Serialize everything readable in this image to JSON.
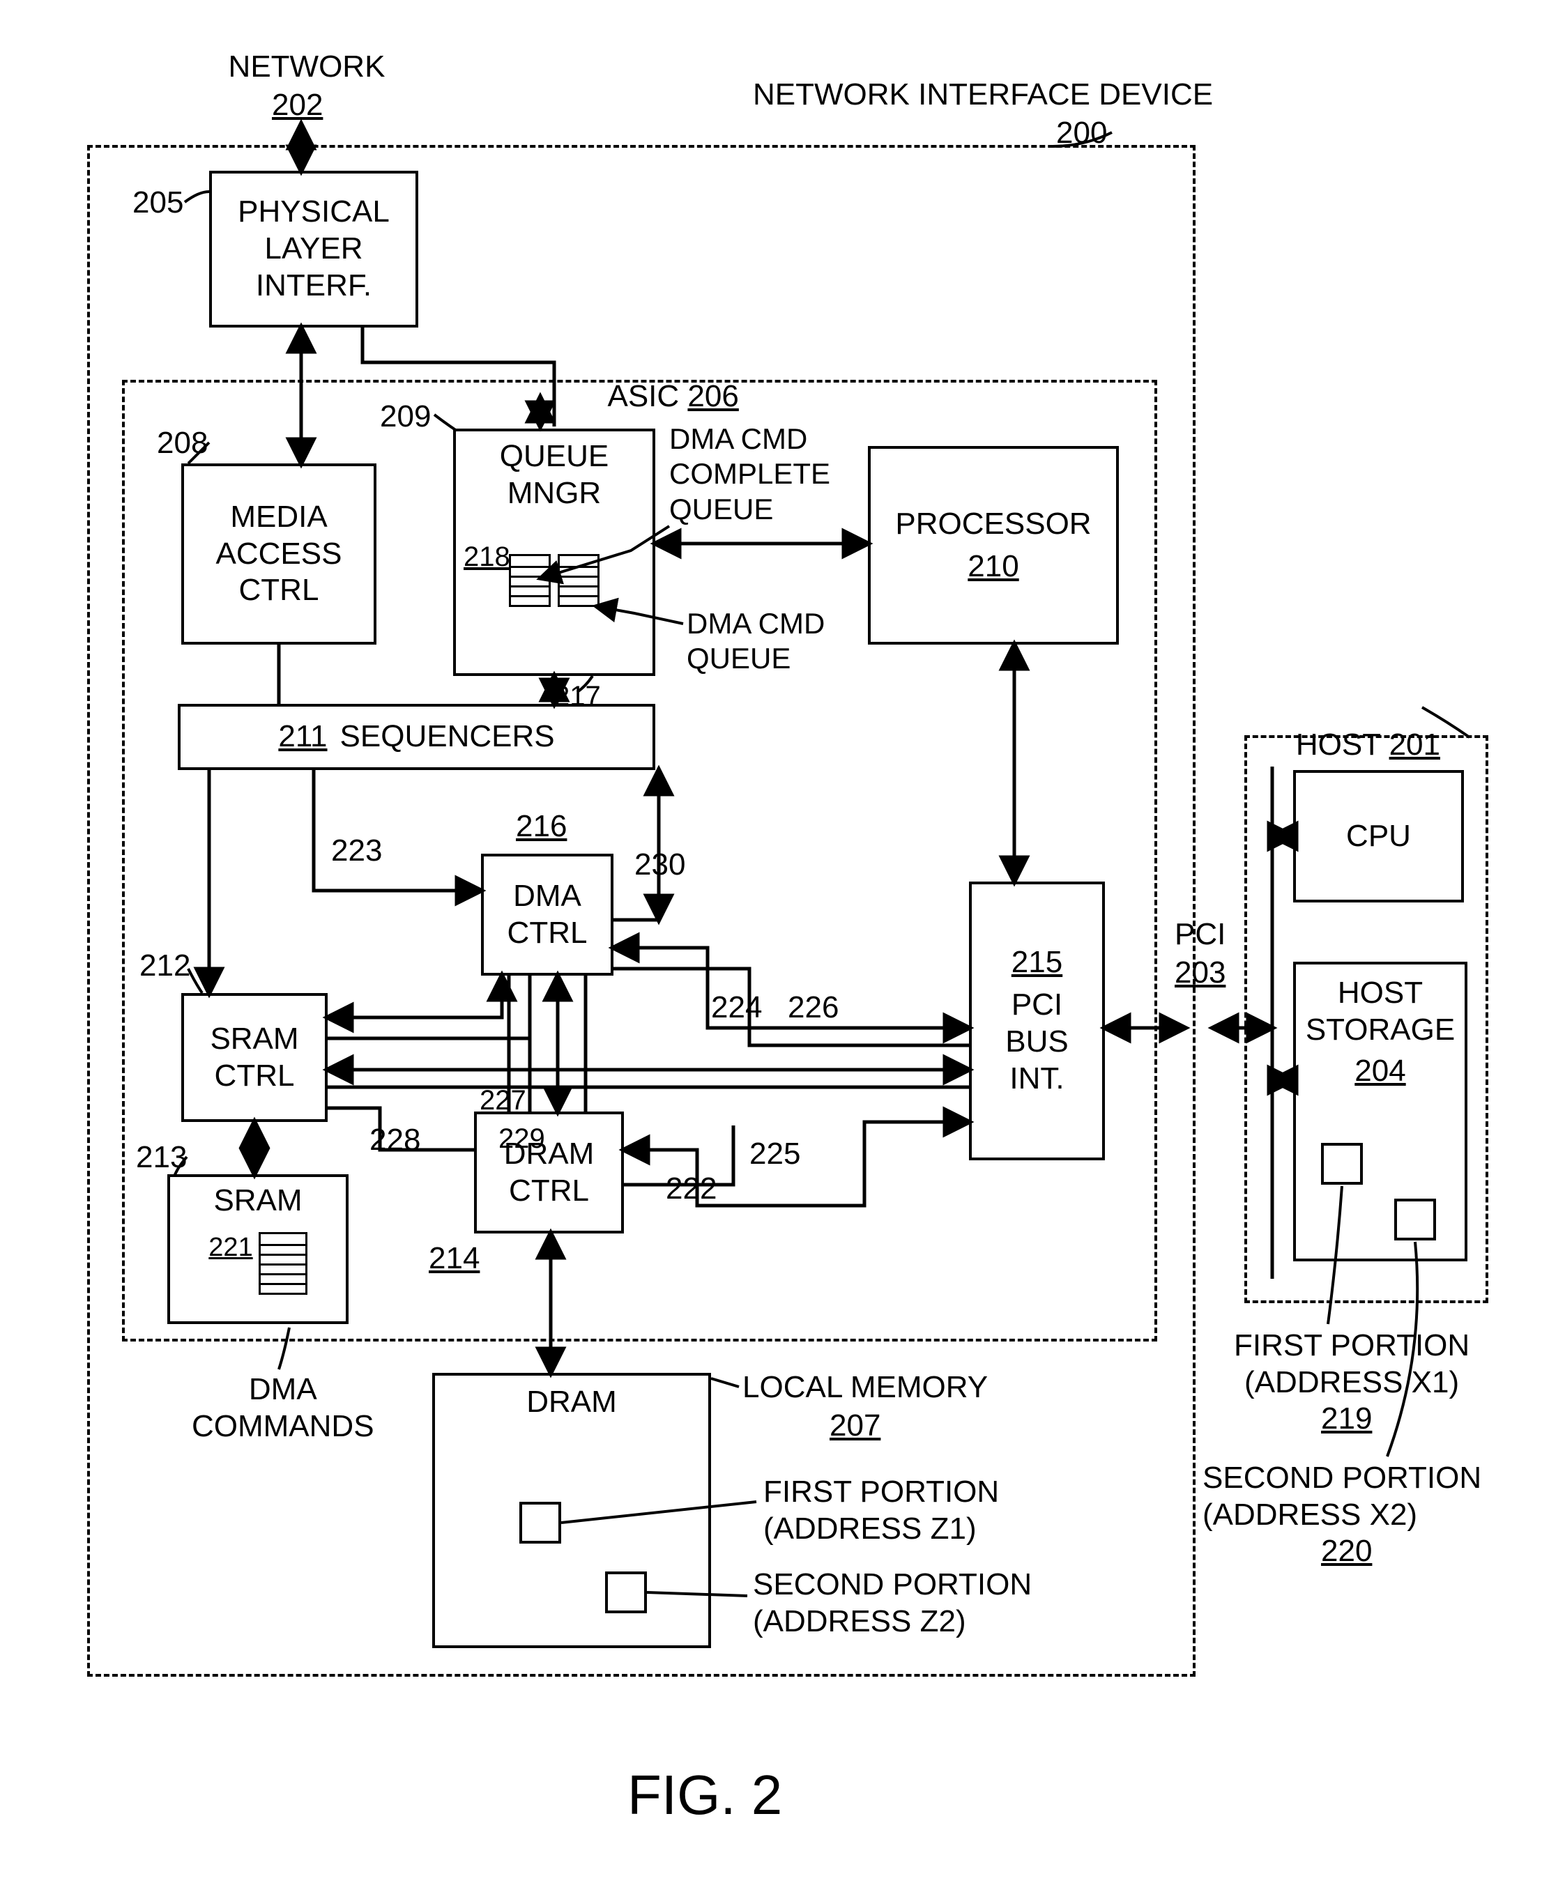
{
  "header": {
    "network": "NETWORK",
    "network_ref": "202",
    "device_title": "NETWORK INTERFACE DEVICE",
    "device_ref": "200"
  },
  "phy": {
    "label": "PHYSICAL\nLAYER\nINTERF.",
    "ref": "205"
  },
  "asic": {
    "label": "ASIC",
    "ref": "206"
  },
  "mac": {
    "label": "MEDIA\nACCESS\nCTRL",
    "ref": "208"
  },
  "qmgr": {
    "label": "QUEUE\nMNGR",
    "ref": "209",
    "q_complete_ref": "218",
    "q_cmd_ref": "217",
    "dma_cmd_complete": "DMA CMD\nCOMPLETE\nQUEUE",
    "dma_cmd_queue": "DMA CMD\nQUEUE"
  },
  "proc": {
    "label": "PROCESSOR",
    "ref": "210"
  },
  "seq": {
    "label": "SEQUENCERS",
    "ref": "211"
  },
  "dmactrl": {
    "label": "DMA\nCTRL",
    "ref": "216"
  },
  "sramctrl": {
    "label": "SRAM\nCTRL",
    "ref": "212"
  },
  "dramctrl": {
    "label": "DRAM\nCTRL",
    "ref": "214"
  },
  "pci_int": {
    "label": "PCI\nBUS\nINT.",
    "ref": "215"
  },
  "sram": {
    "label": "SRAM",
    "ref": "213",
    "cmd_ref": "221",
    "cmds_label": "DMA\nCOMMANDS"
  },
  "dram": {
    "label": "DRAM",
    "local_mem": "LOCAL MEMORY",
    "local_mem_ref": "207",
    "p1": "FIRST PORTION\n(ADDRESS Z1)",
    "p2": "SECOND PORTION\n(ADDRESS Z2)"
  },
  "host": {
    "title": "HOST",
    "ref": "201",
    "cpu": "CPU",
    "storage": "HOST\nSTORAGE",
    "storage_ref": "204",
    "p1": "FIRST PORTION\n(ADDRESS X1)",
    "p1_ref": "219",
    "p2": "SECOND PORTION\n(ADDRESS X2)",
    "p2_ref": "220"
  },
  "pci": {
    "label": "PCI",
    "ref": "203"
  },
  "wires": {
    "w223": "223",
    "w230": "230",
    "w224": "224",
    "w226": "226",
    "w227": "227",
    "w228": "228",
    "w229": "229",
    "w225": "225",
    "w222": "222"
  },
  "figure": "FIG. 2"
}
